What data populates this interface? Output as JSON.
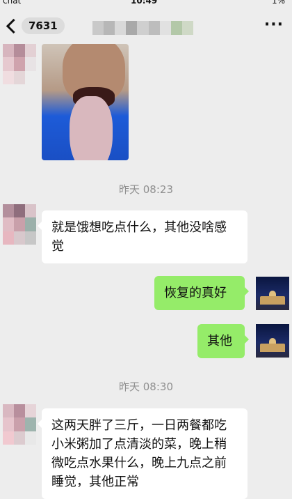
{
  "status_bar": {
    "carrier": "chat",
    "time": "10:49",
    "battery": "1%"
  },
  "nav": {
    "back_count": "7631",
    "title": ""
  },
  "colors": {
    "bubble_in": "#ffffff",
    "bubble_out": "#95ec69",
    "background": "#ededed"
  },
  "messages": [
    {
      "type": "image",
      "from": "contact",
      "description_icon": "photo-icon"
    },
    {
      "type": "timestamp",
      "text": "昨天 08:23"
    },
    {
      "type": "text",
      "from": "contact",
      "text": "就是饿想吃点什么，其他没啥感觉"
    },
    {
      "type": "text",
      "from": "me",
      "text": "恢复的真好"
    },
    {
      "type": "text",
      "from": "me",
      "text": "其他"
    },
    {
      "type": "timestamp",
      "text": "昨天 08:30"
    },
    {
      "type": "text",
      "from": "contact",
      "text": "这两天胖了三斤，一日两餐都吃小米粥加了点清淡的菜，晚上稍微吃点水果什么，晚上九点之前睡觉，其他正常"
    }
  ]
}
